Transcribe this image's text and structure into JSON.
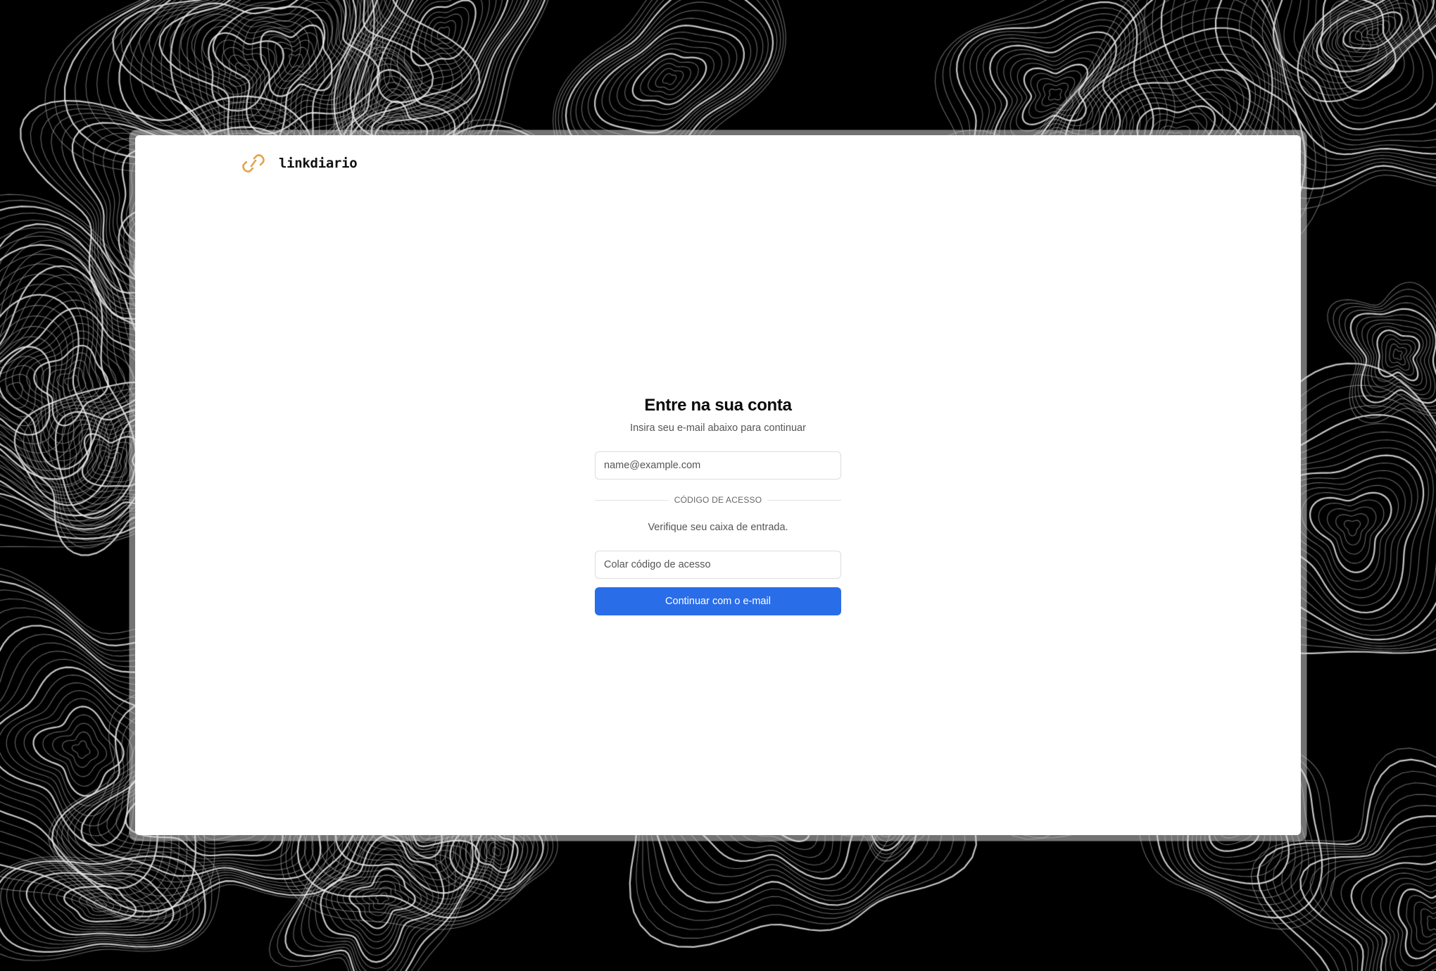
{
  "app": {
    "brand_name": "linkdiario",
    "logo_icon": "link-icon",
    "accent_color": "#e3a24a"
  },
  "login": {
    "title": "Entre na sua conta",
    "subtitle": "Insira seu e-mail abaixo para continuar",
    "email_placeholder": "name@example.com",
    "email_value": "",
    "divider_label": "CÓDIGO DE ACESSO",
    "hint": "Verifique seu caixa de entrada.",
    "code_placeholder": "Colar código de acesso",
    "code_value": "",
    "submit_label": "Continuar com o e-mail",
    "submit_color": "#2a6de9"
  },
  "background": {
    "pattern": "topographic-contour-lines",
    "base_color": "#000000",
    "line_color": "#cfcfcf"
  }
}
